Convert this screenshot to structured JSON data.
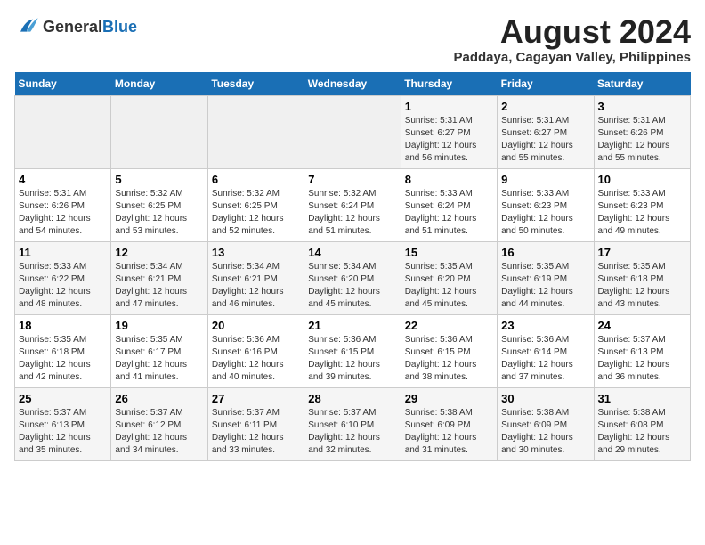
{
  "logo": {
    "line1": "General",
    "line2": "Blue"
  },
  "title": "August 2024",
  "location": "Paddaya, Cagayan Valley, Philippines",
  "weekdays": [
    "Sunday",
    "Monday",
    "Tuesday",
    "Wednesday",
    "Thursday",
    "Friday",
    "Saturday"
  ],
  "weeks": [
    [
      {
        "day": "",
        "info": ""
      },
      {
        "day": "",
        "info": ""
      },
      {
        "day": "",
        "info": ""
      },
      {
        "day": "",
        "info": ""
      },
      {
        "day": "1",
        "info": "Sunrise: 5:31 AM\nSunset: 6:27 PM\nDaylight: 12 hours\nand 56 minutes."
      },
      {
        "day": "2",
        "info": "Sunrise: 5:31 AM\nSunset: 6:27 PM\nDaylight: 12 hours\nand 55 minutes."
      },
      {
        "day": "3",
        "info": "Sunrise: 5:31 AM\nSunset: 6:26 PM\nDaylight: 12 hours\nand 55 minutes."
      }
    ],
    [
      {
        "day": "4",
        "info": "Sunrise: 5:31 AM\nSunset: 6:26 PM\nDaylight: 12 hours\nand 54 minutes."
      },
      {
        "day": "5",
        "info": "Sunrise: 5:32 AM\nSunset: 6:25 PM\nDaylight: 12 hours\nand 53 minutes."
      },
      {
        "day": "6",
        "info": "Sunrise: 5:32 AM\nSunset: 6:25 PM\nDaylight: 12 hours\nand 52 minutes."
      },
      {
        "day": "7",
        "info": "Sunrise: 5:32 AM\nSunset: 6:24 PM\nDaylight: 12 hours\nand 51 minutes."
      },
      {
        "day": "8",
        "info": "Sunrise: 5:33 AM\nSunset: 6:24 PM\nDaylight: 12 hours\nand 51 minutes."
      },
      {
        "day": "9",
        "info": "Sunrise: 5:33 AM\nSunset: 6:23 PM\nDaylight: 12 hours\nand 50 minutes."
      },
      {
        "day": "10",
        "info": "Sunrise: 5:33 AM\nSunset: 6:23 PM\nDaylight: 12 hours\nand 49 minutes."
      }
    ],
    [
      {
        "day": "11",
        "info": "Sunrise: 5:33 AM\nSunset: 6:22 PM\nDaylight: 12 hours\nand 48 minutes."
      },
      {
        "day": "12",
        "info": "Sunrise: 5:34 AM\nSunset: 6:21 PM\nDaylight: 12 hours\nand 47 minutes."
      },
      {
        "day": "13",
        "info": "Sunrise: 5:34 AM\nSunset: 6:21 PM\nDaylight: 12 hours\nand 46 minutes."
      },
      {
        "day": "14",
        "info": "Sunrise: 5:34 AM\nSunset: 6:20 PM\nDaylight: 12 hours\nand 45 minutes."
      },
      {
        "day": "15",
        "info": "Sunrise: 5:35 AM\nSunset: 6:20 PM\nDaylight: 12 hours\nand 45 minutes."
      },
      {
        "day": "16",
        "info": "Sunrise: 5:35 AM\nSunset: 6:19 PM\nDaylight: 12 hours\nand 44 minutes."
      },
      {
        "day": "17",
        "info": "Sunrise: 5:35 AM\nSunset: 6:18 PM\nDaylight: 12 hours\nand 43 minutes."
      }
    ],
    [
      {
        "day": "18",
        "info": "Sunrise: 5:35 AM\nSunset: 6:18 PM\nDaylight: 12 hours\nand 42 minutes."
      },
      {
        "day": "19",
        "info": "Sunrise: 5:35 AM\nSunset: 6:17 PM\nDaylight: 12 hours\nand 41 minutes."
      },
      {
        "day": "20",
        "info": "Sunrise: 5:36 AM\nSunset: 6:16 PM\nDaylight: 12 hours\nand 40 minutes."
      },
      {
        "day": "21",
        "info": "Sunrise: 5:36 AM\nSunset: 6:15 PM\nDaylight: 12 hours\nand 39 minutes."
      },
      {
        "day": "22",
        "info": "Sunrise: 5:36 AM\nSunset: 6:15 PM\nDaylight: 12 hours\nand 38 minutes."
      },
      {
        "day": "23",
        "info": "Sunrise: 5:36 AM\nSunset: 6:14 PM\nDaylight: 12 hours\nand 37 minutes."
      },
      {
        "day": "24",
        "info": "Sunrise: 5:37 AM\nSunset: 6:13 PM\nDaylight: 12 hours\nand 36 minutes."
      }
    ],
    [
      {
        "day": "25",
        "info": "Sunrise: 5:37 AM\nSunset: 6:13 PM\nDaylight: 12 hours\nand 35 minutes."
      },
      {
        "day": "26",
        "info": "Sunrise: 5:37 AM\nSunset: 6:12 PM\nDaylight: 12 hours\nand 34 minutes."
      },
      {
        "day": "27",
        "info": "Sunrise: 5:37 AM\nSunset: 6:11 PM\nDaylight: 12 hours\nand 33 minutes."
      },
      {
        "day": "28",
        "info": "Sunrise: 5:37 AM\nSunset: 6:10 PM\nDaylight: 12 hours\nand 32 minutes."
      },
      {
        "day": "29",
        "info": "Sunrise: 5:38 AM\nSunset: 6:09 PM\nDaylight: 12 hours\nand 31 minutes."
      },
      {
        "day": "30",
        "info": "Sunrise: 5:38 AM\nSunset: 6:09 PM\nDaylight: 12 hours\nand 30 minutes."
      },
      {
        "day": "31",
        "info": "Sunrise: 5:38 AM\nSunset: 6:08 PM\nDaylight: 12 hours\nand 29 minutes."
      }
    ]
  ]
}
